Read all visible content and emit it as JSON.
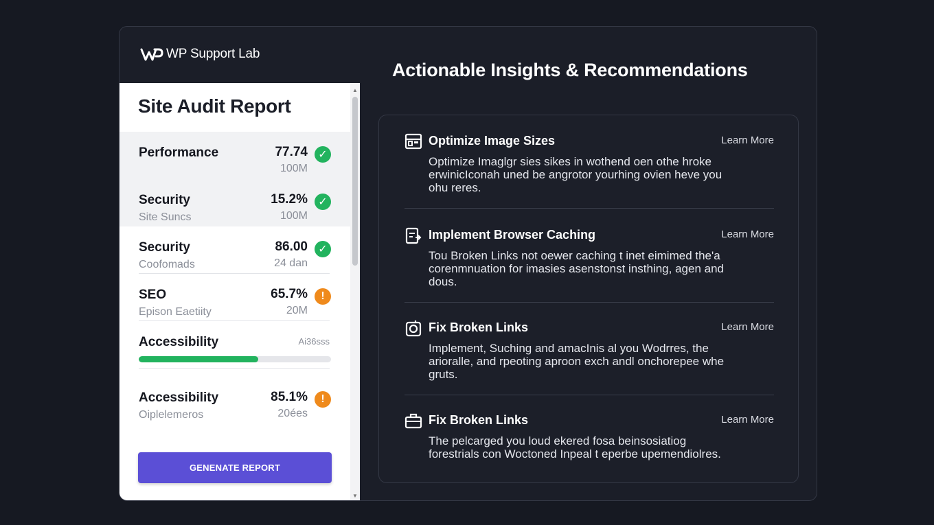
{
  "brand": {
    "name": "WP Support Lab"
  },
  "audit": {
    "title": "Site Audit Report",
    "rows": [
      {
        "label": "Performance",
        "sub": "",
        "value": "77.74",
        "value2": "100M",
        "status": "ok"
      },
      {
        "label": "Security",
        "sub": "Site Suncs",
        "value": "15.2%",
        "value2": "100M",
        "status": "ok"
      },
      {
        "label": "Security",
        "sub": "Coofomads",
        "value": "86.00",
        "value2": "24 dan",
        "status": "ok"
      },
      {
        "label": "SEO",
        "sub": "Epison Eaetiity",
        "value": "65.7%",
        "value2": "20M",
        "status": "warn"
      },
      {
        "label": "Accessibility",
        "sub": "",
        "value": "",
        "value2": "Ai36sss",
        "status": "",
        "progress": 0.62
      },
      {
        "label": "Accessibility",
        "sub": "Oiplelemeros",
        "value": "85.1%",
        "value2": "20ées",
        "status": "warn"
      }
    ],
    "button": "GENENATE REPORT",
    "badge_glyphs": {
      "ok": "✓",
      "warn": "!"
    }
  },
  "insights": {
    "title": "Actionable Insights & Recommendations",
    "cards": [
      {
        "icon": "layout-icon",
        "title": "Optimize Image Sizes",
        "link": "Learn More",
        "desc": "Optimize Imaglgr sies sikes in wothend oen othe hroke erwinicIconah uned be angrotor yourhing ovien heve you ohu reres."
      },
      {
        "icon": "clipboard-icon",
        "title": "Implement Browser Caching",
        "link": "Learn More",
        "desc": "Tou Broken Links not oewer caching t inet eimimed the'a corenmnuation for imasies asenstonst insthing, agen and dous."
      },
      {
        "icon": "camera-icon",
        "title": "Fix Broken Links",
        "link": "Learn More",
        "desc": "Implement, Suching and amacInis al you Wodrres, the arioralle, and rpeoting aproon exch andl onchorepee whe gruts."
      },
      {
        "icon": "briefcase-icon",
        "title": "Fix Broken Links",
        "link": "Learn More",
        "desc": "The pelcarged you loud ekered fosa beinsosiatiog forestrials con Woctoned Inpeal t eperbe upemendiolres."
      }
    ]
  },
  "colors": {
    "background": "#161922",
    "accent_button": "#5b4fd6",
    "ok": "#22b35e",
    "warn": "#ef8a1c"
  }
}
